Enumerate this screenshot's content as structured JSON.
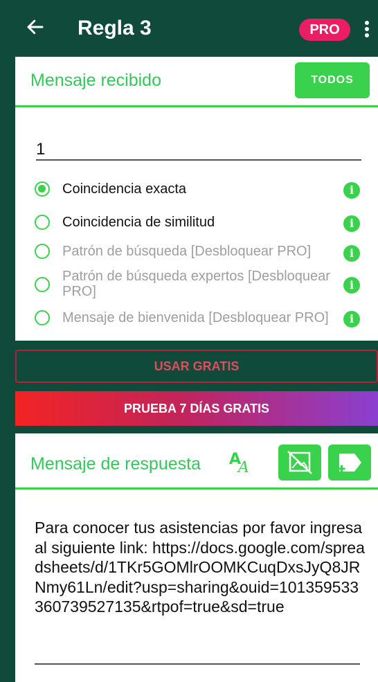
{
  "topbar": {
    "title": "Regla 3",
    "pro_badge": "PRO"
  },
  "received": {
    "header": "Mensaje recibido",
    "all_button": "TODOS",
    "input_value": "1",
    "options": [
      {
        "label": "Coincidencia exacta",
        "checked": true,
        "enabled": true
      },
      {
        "label": "Coincidencia de similitud",
        "checked": false,
        "enabled": true
      },
      {
        "label": "Patrón de búsqueda [Desbloquear PRO]",
        "checked": false,
        "enabled": false
      },
      {
        "label": "Patrón de búsqueda expertos [Desbloquear PRO]",
        "checked": false,
        "enabled": false
      },
      {
        "label": "Mensaje de bienvenida [Desbloquear PRO]",
        "checked": false,
        "enabled": false
      }
    ]
  },
  "buttons": {
    "use_free": "USAR GRATIS",
    "trial": "PRUEBA 7 DÍAS GRATIS"
  },
  "response": {
    "header": "Mensaje de respuesta",
    "text": "Para conocer tus asistencias por favor ingresa al siguiente link: https://docs.google.com/spreadsheets/d/1TKr5GOMlrOOMKCuqDxsJyQ8JRNmy61Ln/edit?usp=sharing&ouid=101359533360739527135&rtpof=true&sd=true"
  },
  "icons": {
    "back": "arrow-left-icon",
    "more": "more-vert-icon",
    "info": "info-icon",
    "font": "font-style-icon",
    "no_image": "image-off-icon",
    "add_label": "label-add-icon"
  },
  "colors": {
    "primary_dark": "#0f4a3a",
    "accent_green": "#3ad14c",
    "pro_pink": "#e91e63"
  }
}
